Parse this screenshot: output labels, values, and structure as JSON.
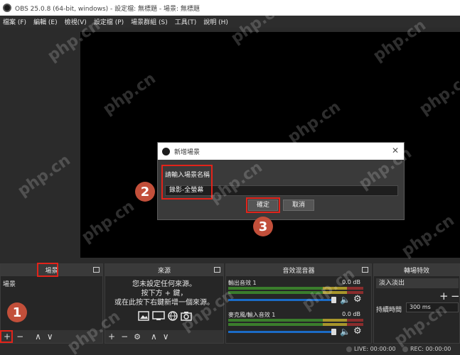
{
  "window": {
    "title": "OBS 25.0.8 (64-bit, windows) - 設定檔: 無標題 - 場景: 無標題"
  },
  "menu": [
    "檔案 (F)",
    "編輯 (E)",
    "檢視(V)",
    "設定檔 (P)",
    "場景群組 (S)",
    "工具(T)",
    "說明 (H)"
  ],
  "dialog": {
    "title": "新增場景",
    "close_glyph": "✕",
    "label": "請輸入場景名稱",
    "input_value": "錄影-全螢幕",
    "ok_label": "確定",
    "cancel_label": "取消"
  },
  "docks": {
    "scenes": {
      "title": "場景",
      "item": "場景"
    },
    "sources": {
      "title": "來源",
      "hint_line1": "您未設定任何來源。",
      "hint_line2": "按下方 + 鍵，",
      "hint_line3": "或在此按下右鍵新增一個來源。"
    },
    "mixer": {
      "title": "音效混音器",
      "channels": [
        {
          "name": "輸出音效 1",
          "db": "0.0 dB"
        },
        {
          "name": "麥克風/輸入音效 1",
          "db": "0.0 dB"
        }
      ]
    },
    "transitions": {
      "title": "轉場特效",
      "selected": "淡入淡出",
      "duration_label": "持續時間",
      "duration_value": "300 ms"
    }
  },
  "footer_icons": {
    "add": "+",
    "remove": "−",
    "gear": "⚙",
    "up": "∧",
    "down": "∨"
  },
  "status": {
    "live": "LIVE: 00:00:00",
    "rec": "REC: 00:00:00"
  },
  "annotations": [
    "1",
    "2",
    "3"
  ],
  "watermark": "php.cn"
}
